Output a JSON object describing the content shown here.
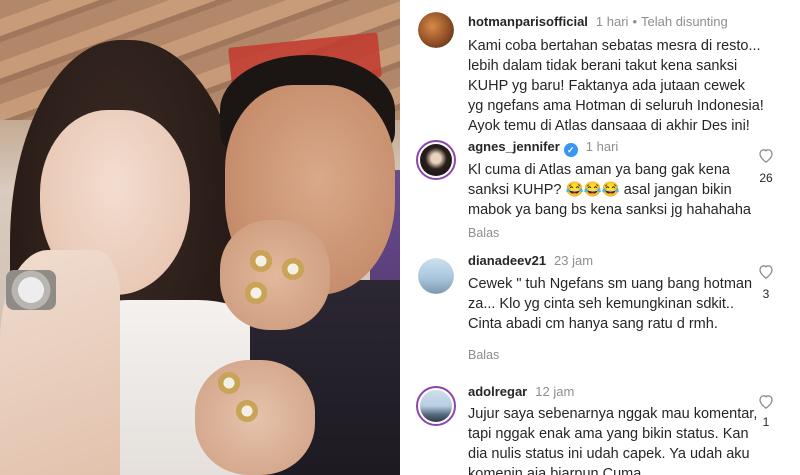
{
  "post": {
    "username": "hotmanparisofficial",
    "time": "1 hari",
    "edited": "Telah disunting",
    "caption": "Kami coba bertahan sebatas mesra di resto... lebih dalam tidak berani takut kena sanksi KUHP yg baru! Faktanya ada jutaan cewek yg ngefans ama Hotman di seluruh Indonesia! Ayok temu di Atlas dansaaa di akhir Des ini!"
  },
  "comments": [
    {
      "username": "agnes_jennifer",
      "verified": true,
      "time": "1 hari",
      "text": "Kl cuma di Atlas aman ya bang gak kena sanksi KUHP? 😂😂😂 asal jangan bikin mabok ya bang bs kena sanksi jg hahahaha",
      "reply_label": "Balas",
      "likes": "26"
    },
    {
      "username": "dianadeev21",
      "verified": false,
      "time": "23 jam",
      "text": "Cewek \" tuh Ngefans sm uang bang hotman za... Klo yg cinta seh kemungkinan sdkit.. Cinta abadi cm hanya sang ratu d rmh.",
      "reply_label": "Balas",
      "likes": "3"
    },
    {
      "username": "adolregar",
      "verified": false,
      "time": "12 jam",
      "text": "Jujur saya sebenarnya nggak mau komentar, tapi nggak enak ama yang bikin status. Kan dia nulis status ini udah capek. Ya udah aku komenin aja biarpun Cuma",
      "likes": "1"
    }
  ],
  "icons": {
    "like": "heart-icon",
    "verified": "verified-badge-icon"
  },
  "colors": {
    "verified": "#3897f0",
    "muted": "#8e8e8e",
    "text": "#262626",
    "story_ring": "#8e44ad"
  }
}
